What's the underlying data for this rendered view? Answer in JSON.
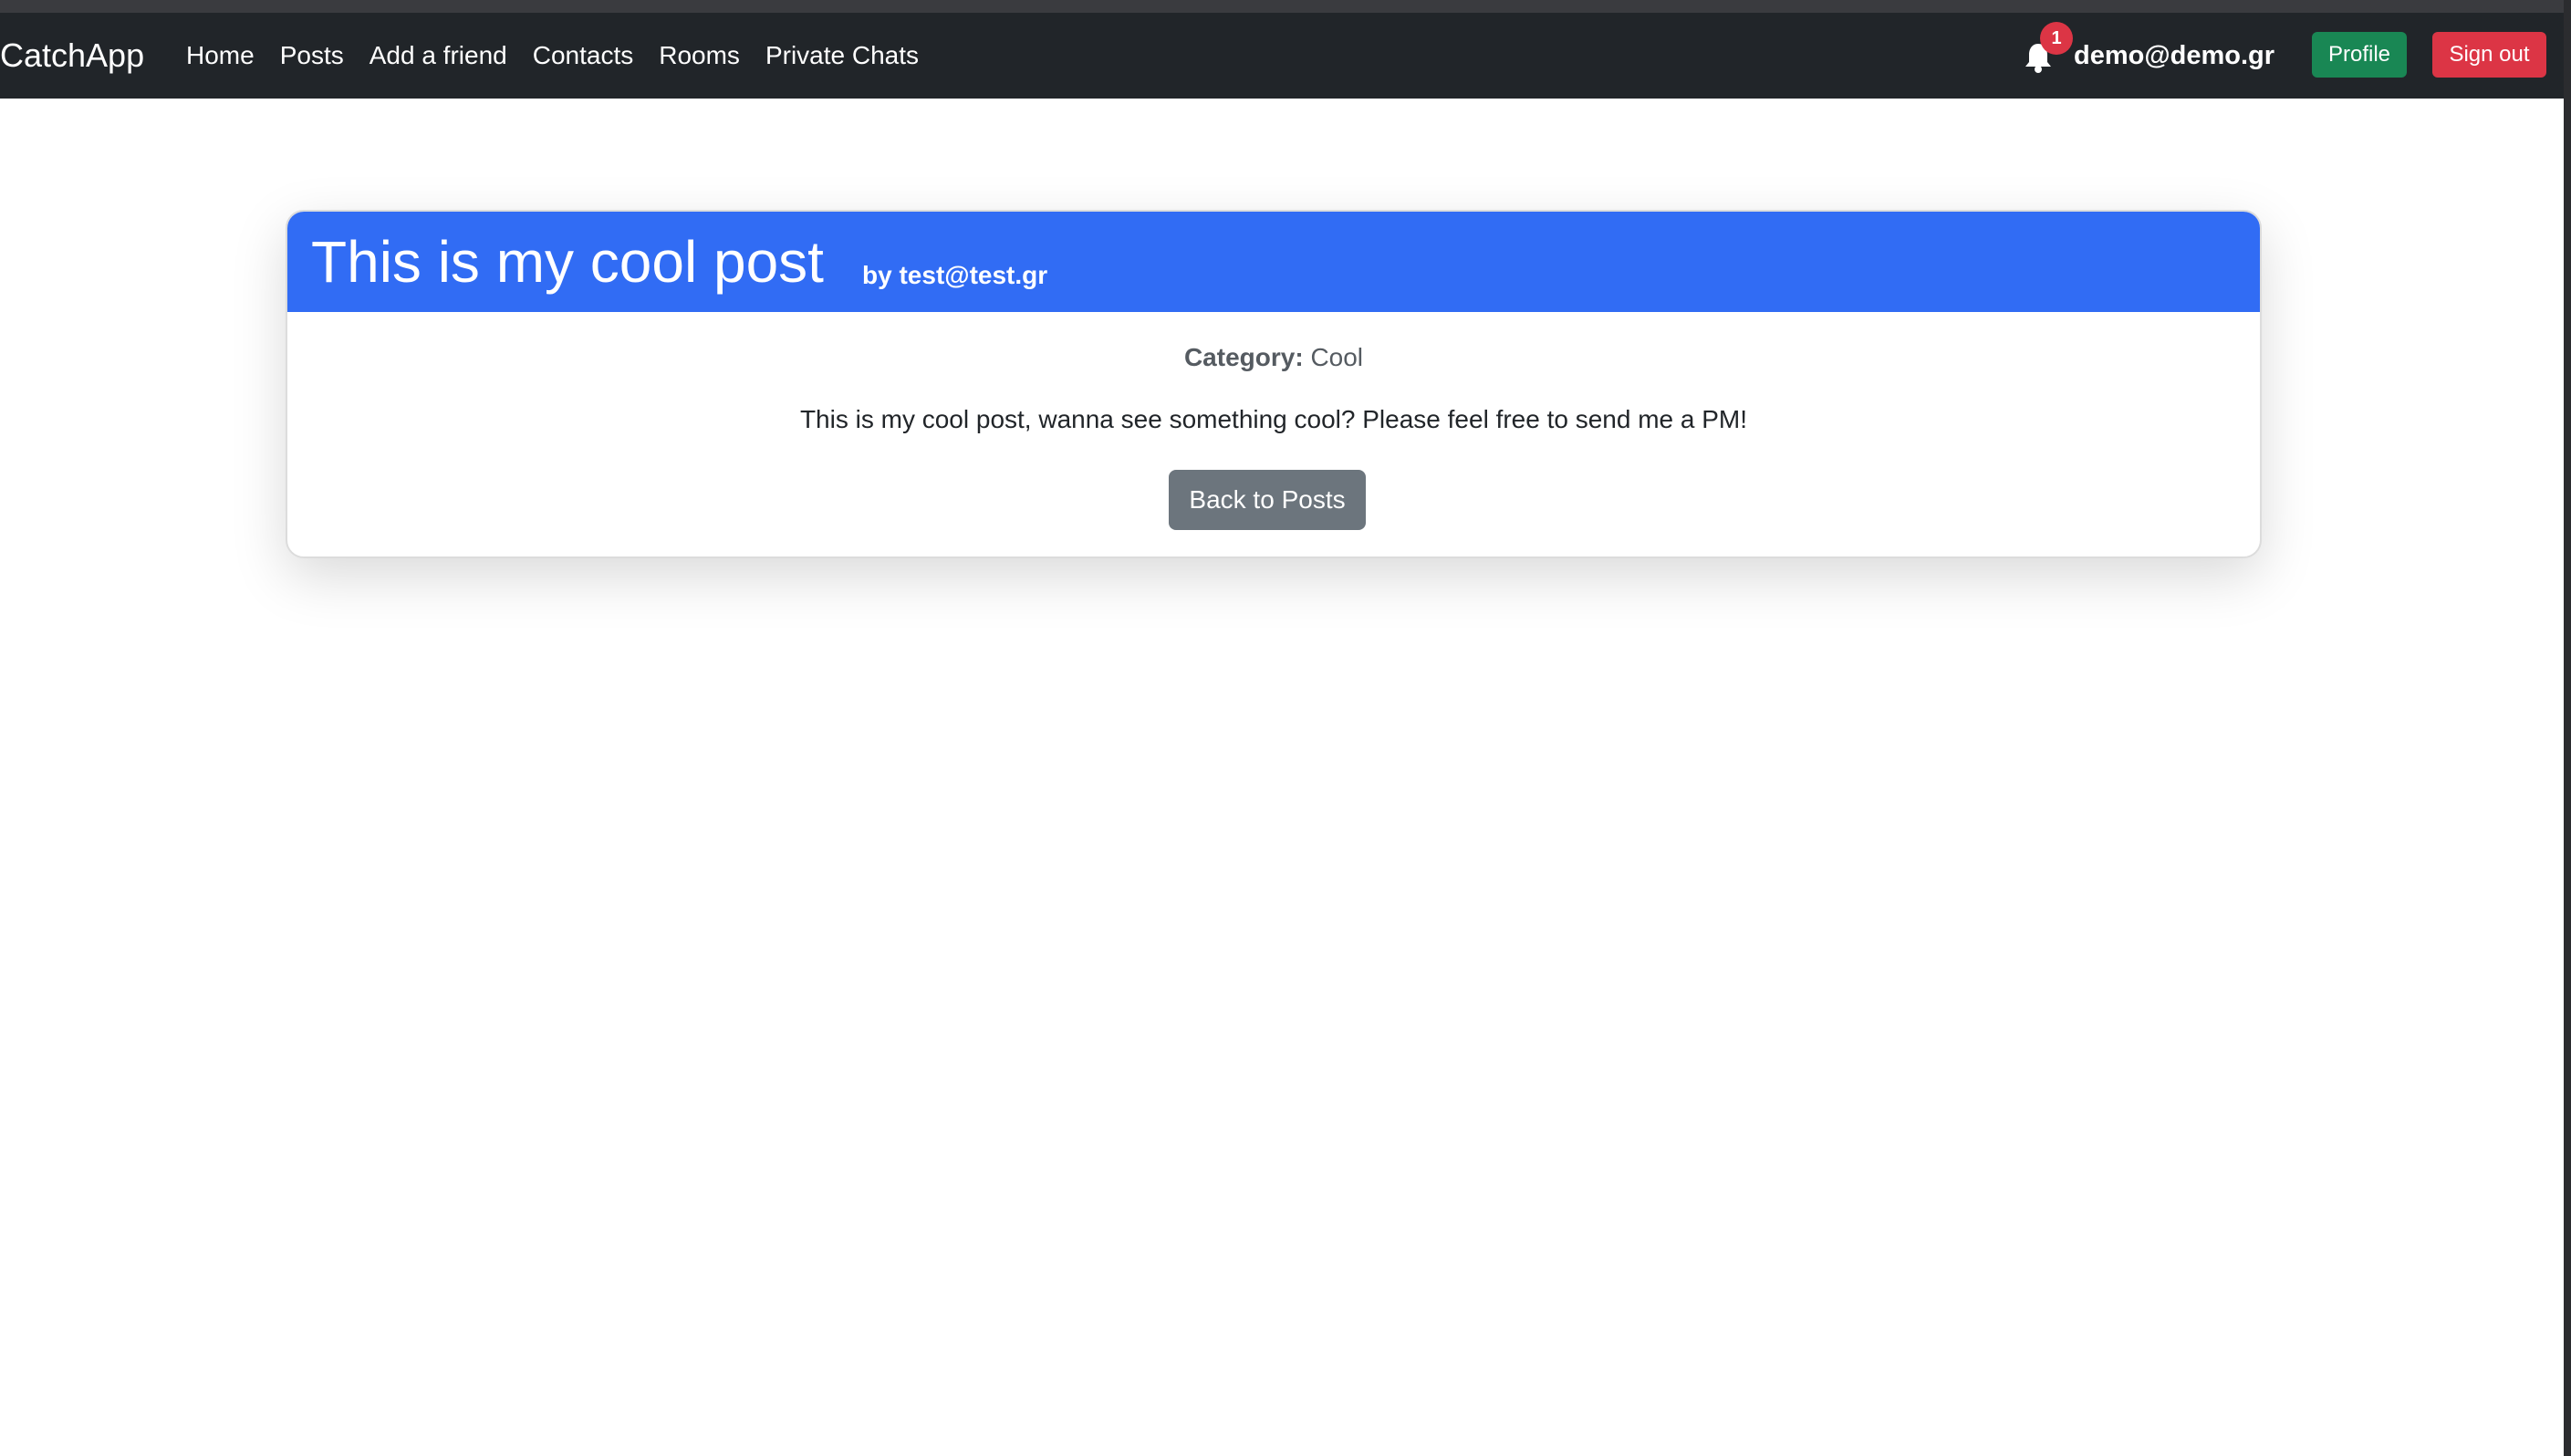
{
  "navbar": {
    "brand": "CatchApp",
    "links": [
      "Home",
      "Posts",
      "Add a friend",
      "Contacts",
      "Rooms",
      "Private Chats"
    ],
    "notification_count": "1",
    "user_email": "demo@demo.gr",
    "profile_label": "Profile",
    "signout_label": "Sign out"
  },
  "post": {
    "title": "This is my cool post",
    "author_prefix": "by",
    "author": "test@test.gr",
    "category_label": "Category:",
    "category_value": "Cool",
    "body": "This is my cool post, wanna see something cool? Please feel free to send me a PM!",
    "back_button_label": "Back to Posts"
  },
  "colors": {
    "navbar_bg": "#212529",
    "header_blue": "#316cf4",
    "profile_green": "#198754",
    "signout_red": "#dc3545",
    "back_gray": "#6c757d"
  },
  "icons": {
    "notifications": "bell-icon"
  }
}
